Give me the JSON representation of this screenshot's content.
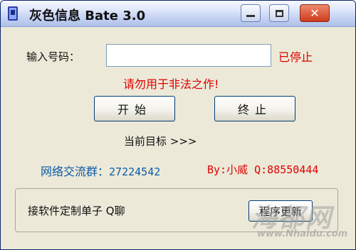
{
  "window": {
    "title": "灰色信息 Bate 3.0",
    "icon": "app-icon",
    "controls": {
      "minimize": "minimize-icon",
      "maximize": "maximize-icon",
      "close": "close-icon"
    }
  },
  "form": {
    "number_label": "输入号码：",
    "number_value": "",
    "status": "已停止",
    "warning": "请勿用于非法之作!"
  },
  "buttons": {
    "start": "开始",
    "stop": "终止",
    "update": "程序更新"
  },
  "target_label": "当前目标 >>>",
  "group": {
    "label": "网络交流群：",
    "number": "27224542"
  },
  "author": "By:小威 Q:88550444",
  "panel_text": "接软件定制单子 Q聊",
  "watermark": {
    "text": "海都网",
    "url": "www.Nhaidu.com"
  },
  "colors": {
    "status_red": "#e00000",
    "group_blue": "#0b5aa8",
    "titlebar": "#c6d3f4"
  }
}
